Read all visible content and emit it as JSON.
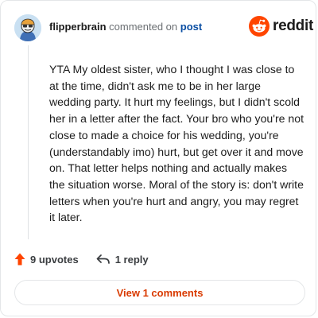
{
  "header": {
    "username": "flipperbrain",
    "action_text": "commented on",
    "post_link": "post"
  },
  "brand": {
    "wordmark": "reddit",
    "logo_color": "#ff4500"
  },
  "comment": {
    "body": "YTA My oldest sister, who I thought I was close to at the time, didn't ask me to be in her large wedding party. It hurt my feelings, but I didn't scold her in a letter after the fact. Your bro who you're not close to made a choice for his wedding, you're (understandably imo) hurt, but get over it and move on. That letter helps nothing and actually makes the situation worse. Moral of the story is: don't write letters when you're hurt and angry, you may regret it later."
  },
  "actions": {
    "upvotes": "9 upvotes",
    "replies": "1 reply"
  },
  "footer": {
    "view_comments": "View 1 comments"
  },
  "colors": {
    "accent": "#d93a00",
    "upvote": "#ff4500",
    "link": "#0a4ea3"
  },
  "icons": {
    "avatar": "avatar",
    "logo": "reddit-snoo-icon",
    "upvote": "upvote-arrow-icon",
    "reply": "reply-arrow-icon"
  }
}
